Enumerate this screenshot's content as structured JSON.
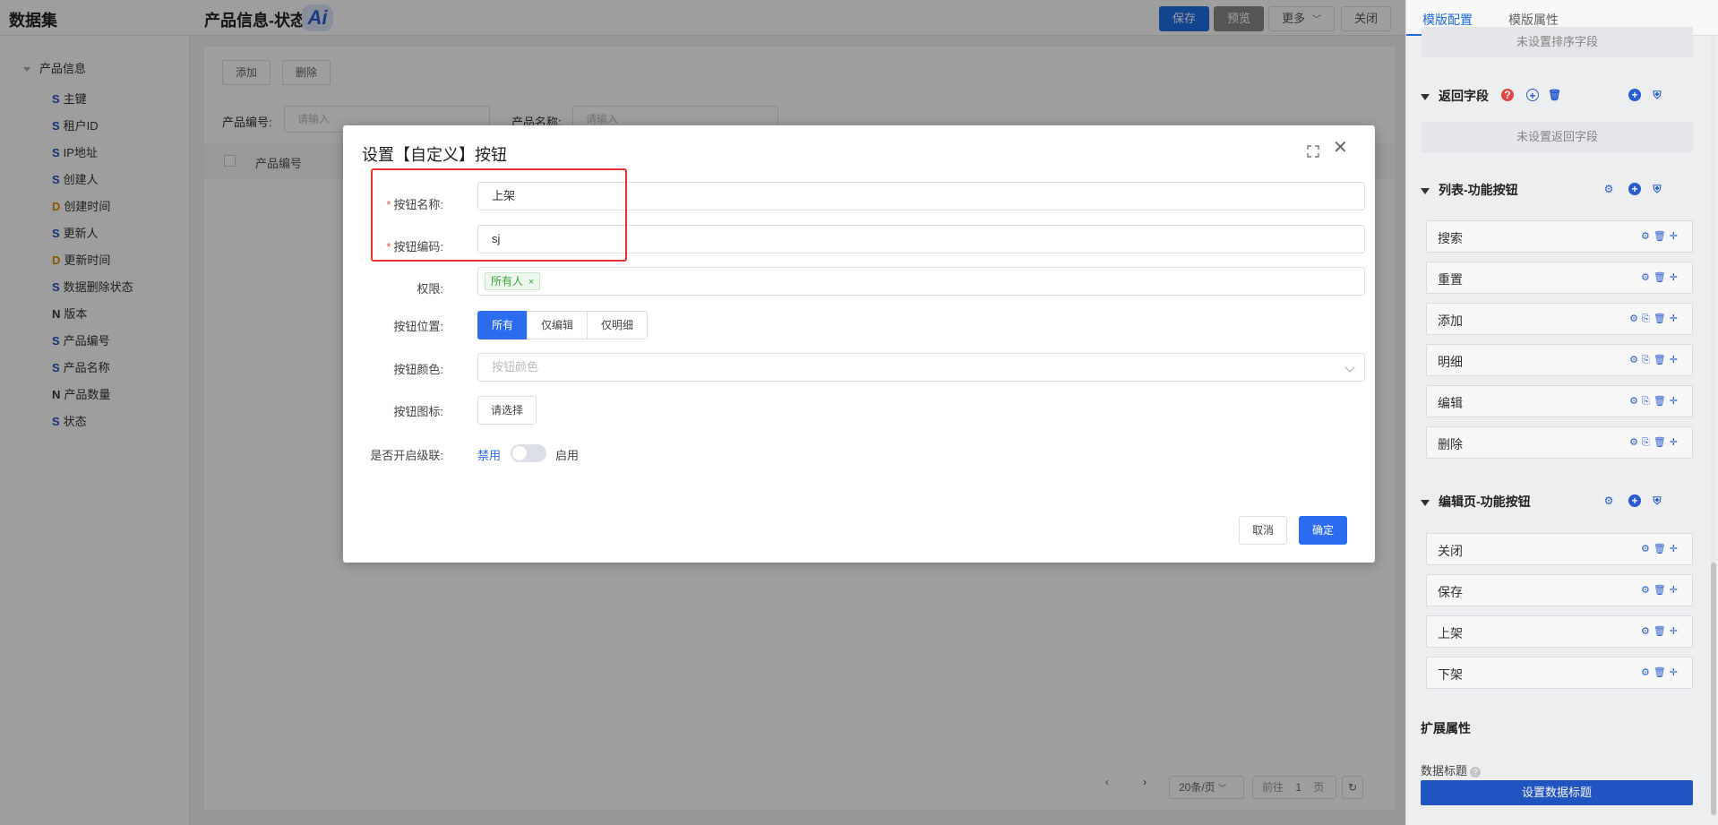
{
  "app": {
    "title": "数据集"
  },
  "header": {
    "page_title": "产品信息-状态",
    "ai_badge": "Ai",
    "save": "保存",
    "preview": "预览",
    "more": "更多",
    "close": "关闭"
  },
  "sidebar": {
    "root": "产品信息",
    "items": [
      {
        "type": "S",
        "label": "主键"
      },
      {
        "type": "S",
        "label": "租户ID"
      },
      {
        "type": "S",
        "label": "IP地址"
      },
      {
        "type": "S",
        "label": "创建人"
      },
      {
        "type": "D",
        "label": "创建时间"
      },
      {
        "type": "S",
        "label": "更新人"
      },
      {
        "type": "D",
        "label": "更新时间"
      },
      {
        "type": "S",
        "label": "数据删除状态"
      },
      {
        "type": "N",
        "label": "版本"
      },
      {
        "type": "S",
        "label": "产品编号"
      },
      {
        "type": "S",
        "label": "产品名称"
      },
      {
        "type": "N",
        "label": "产品数量"
      },
      {
        "type": "S",
        "label": "状态"
      }
    ]
  },
  "main": {
    "add": "添加",
    "delete": "删除",
    "search1_label": "产品编号:",
    "search1_placeholder": "请输入",
    "search2_label": "产品名称:",
    "search2_placeholder": "请输入",
    "col1": "产品编号",
    "pager": {
      "page_size": "20条/页",
      "goto": "前往",
      "page": "1",
      "page_unit": "页"
    }
  },
  "right": {
    "tab1": "模版配置",
    "tab2": "模版属性",
    "sort_placeholder": "未设置排序字段",
    "return_title": "返回字段",
    "return_placeholder": "未设置返回字段",
    "list_title": "列表-功能按钮",
    "list_buttons": [
      "搜索",
      "重置",
      "添加",
      "明细",
      "编辑",
      "删除"
    ],
    "edit_title": "编辑页-功能按钮",
    "edit_buttons": [
      "关闭",
      "保存",
      "上架",
      "下架"
    ],
    "ext_title": "扩展属性",
    "data_title_label": "数据标题",
    "data_title_btn": "设置数据标题"
  },
  "modal": {
    "title": "设置【自定义】按钮",
    "name_label": "按钮名称:",
    "name_value": "上架",
    "code_label": "按钮编码:",
    "code_value": "sj",
    "perm_label": "权限:",
    "perm_tag": "所有人",
    "pos_label": "按钮位置:",
    "pos_options": [
      "所有",
      "仅编辑",
      "仅明细"
    ],
    "pos_selected": "所有",
    "color_label": "按钮颜色:",
    "color_placeholder": "按钮颜色",
    "icon_label": "按钮图标:",
    "icon_btn": "请选择",
    "cascade_label": "是否开启级联:",
    "cascade_off": "禁用",
    "cascade_on": "启用",
    "cascade_enabled": false,
    "cancel": "取消",
    "ok": "确定"
  },
  "colors": {
    "primary": "#2b6cf0",
    "highlight": "#e8322f"
  }
}
